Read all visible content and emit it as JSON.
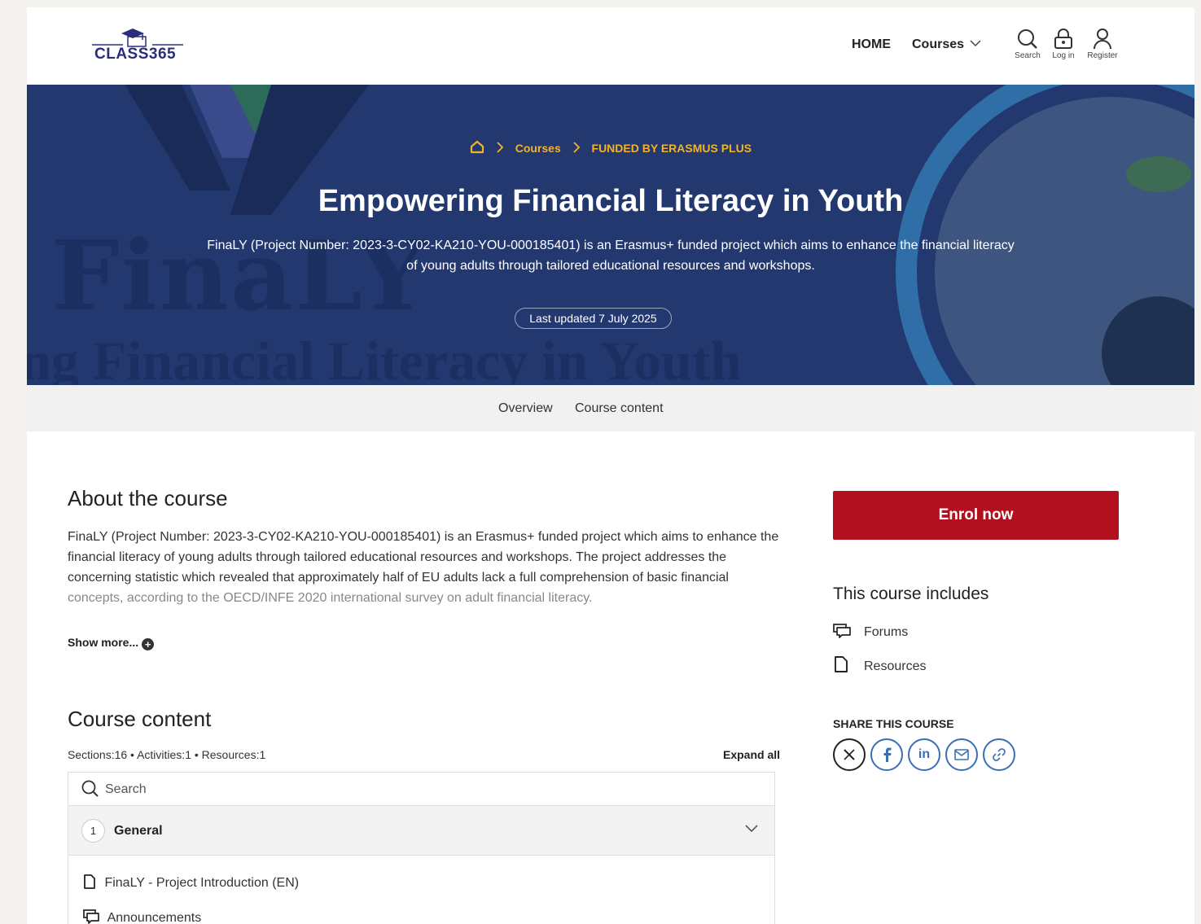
{
  "header": {
    "logo_text": "CLASS365",
    "nav_home": "HOME",
    "nav_courses": "Courses",
    "search_label": "Search",
    "login_label": "Log in",
    "register_label": "Register"
  },
  "hero": {
    "breadcrumb_courses": "Courses",
    "breadcrumb_category": "FUNDED BY ERASMUS PLUS",
    "title": "Empowering Financial Literacy in Youth",
    "description": "FinaLY (Project Number: 2023-3-CY02-KA210-YOU-000185401) is an Erasmus+ funded project which aims to enhance the financial literacy of young adults through tailored educational resources and workshops.",
    "last_updated": "Last updated 7 July 2025",
    "watermark_line1": "FinaLY",
    "watermark_line2": "ng Financial Literacy in Youth"
  },
  "tabs": {
    "overview": "Overview",
    "course_content": "Course content"
  },
  "about": {
    "title": "About the course",
    "text": "FinaLY (Project Number: 2023-3-CY02-KA210-YOU-000185401) is an Erasmus+ funded project which aims to enhance the financial literacy of young adults through tailored educational resources and workshops. The project addresses the concerning statistic which revealed that approximately half of EU adults lack a full comprehension of basic financial",
    "text_fade": "concepts, according to the OECD/INFE 2020 international survey on adult financial literacy.",
    "show_more": "Show more..."
  },
  "course_content": {
    "title": "Course content",
    "stats": "Sections:16 • Activities:1 • Resources:1",
    "expand_all": "Expand all",
    "search_placeholder": "Search",
    "section_number": "1",
    "section_name": "General",
    "activities": [
      "FinaLY - Project Introduction (EN)",
      "Announcements"
    ]
  },
  "sidebar": {
    "enrol_label": "Enrol now",
    "includes_title": "This course includes",
    "includes": [
      "Forums",
      "Resources"
    ],
    "share_title": "SHARE THIS COURSE",
    "share_linkedin": "in"
  },
  "colors": {
    "hero_bg": "#23386e",
    "accent_gold": "#f2b32b",
    "enrol_red": "#b3101f",
    "share_blue": "#3a6fb7"
  }
}
